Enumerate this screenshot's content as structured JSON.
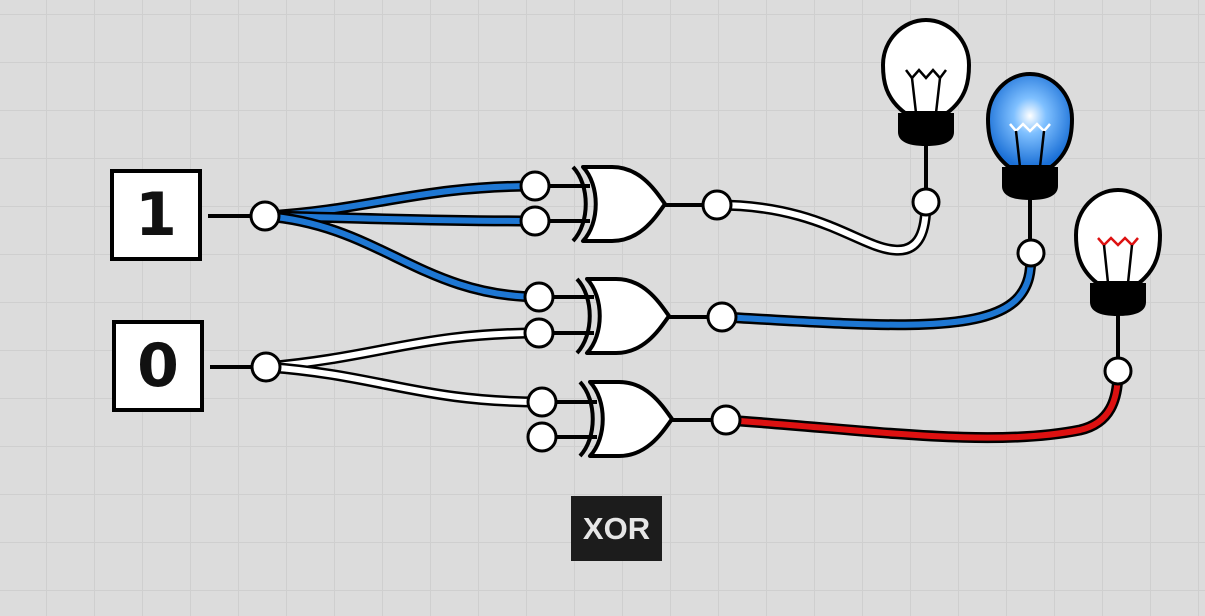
{
  "inputs": [
    {
      "id": "input-1",
      "value": "1",
      "state": "high"
    },
    {
      "id": "input-0",
      "value": "0",
      "state": "low"
    }
  ],
  "gates": [
    {
      "type": "XOR",
      "inputs": [
        "1",
        "1"
      ],
      "output_state": "low"
    },
    {
      "type": "XOR",
      "inputs": [
        "1",
        "0"
      ],
      "output_state": "high"
    },
    {
      "type": "XOR",
      "inputs": [
        "0",
        "disconnected"
      ],
      "output_state": "error"
    }
  ],
  "outputs": [
    {
      "name": "bulb-1",
      "state": "off"
    },
    {
      "name": "bulb-2",
      "state": "on"
    },
    {
      "name": "bulb-3",
      "state": "error"
    }
  ],
  "gate_label": "XOR",
  "colors": {
    "background": "#dcdcdc",
    "grid": "#cfcfcf",
    "wire_high": "#1e77d3",
    "wire_low": "#ffffff",
    "wire_error": "#dd1111",
    "outline": "#000000",
    "label_background": "#1c1c1c"
  }
}
